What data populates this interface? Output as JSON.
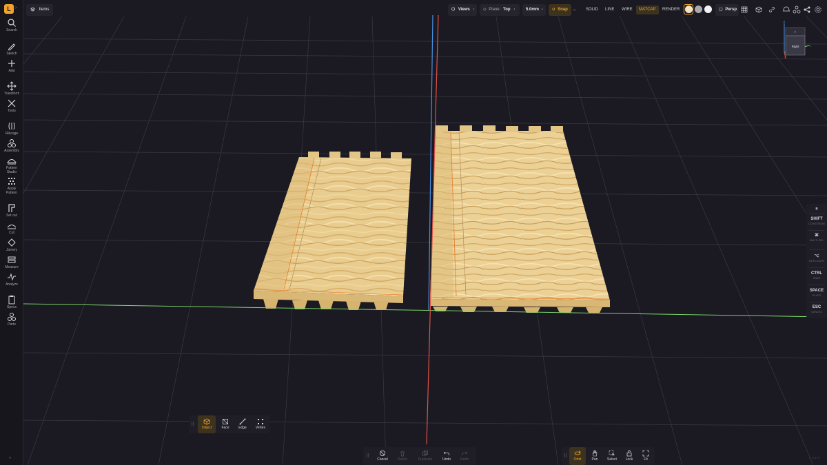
{
  "app": {
    "logo_letter": "L",
    "items_tab_label": "Items",
    "colors": {
      "accent": "#f0a22a",
      "background": "#1b1a22",
      "panel": "#1f1e26",
      "x_axis": "#e0524a",
      "y_axis": "#7cd66a",
      "z_axis": "#4a90e2"
    }
  },
  "left_toolbar": {
    "tools": [
      {
        "label": "Search",
        "icon": "search-icon"
      },
      {
        "label": "Sketch",
        "icon": "pencil-icon"
      },
      {
        "label": "Add",
        "icon": "plus-icon"
      },
      {
        "label": "Transform",
        "icon": "move-icon"
      },
      {
        "label": "Tools",
        "icon": "wrench-icon"
      },
      {
        "label": "Ribcage",
        "icon": "ribcage-icon"
      },
      {
        "label": "Assembly",
        "icon": "assembly-icon"
      },
      {
        "label": "Pattern\nStudio",
        "icon": "pattern-studio-icon"
      },
      {
        "label": "Apply\nPattern",
        "icon": "apply-pattern-icon"
      },
      {
        "label": "Set out",
        "icon": "set-out-icon"
      },
      {
        "label": "Cut",
        "icon": "cut-icon"
      },
      {
        "label": "Joinery",
        "icon": "joinery-icon"
      },
      {
        "label": "Measure",
        "icon": "measure-icon"
      },
      {
        "label": "Analyze",
        "icon": "analyze-icon"
      },
      {
        "label": "Specs",
        "icon": "clipboard-icon"
      },
      {
        "label": "Parts",
        "icon": "parts-icon"
      }
    ]
  },
  "top_bar": {
    "views_label": "Views",
    "plane_label": "Plane:",
    "plane_value": "Top",
    "step_value": "5.0mm",
    "snap_label": "Snap",
    "render_modes": [
      "SOLID",
      "LINE",
      "WIRE",
      "MATCAP",
      "RENDER"
    ],
    "active_render_mode": "MATCAP",
    "projection_label": "Persp"
  },
  "viewcube": {
    "top_label": "F",
    "front_label": "Right",
    "axis_z": "Z",
    "axis_y": "Y",
    "axis_x": "X"
  },
  "shortcuts": [
    {
      "key": "SHIFT",
      "desc": "CONSTRAIN"
    },
    {
      "key": "⌘",
      "desc": "MULTI SEL"
    },
    {
      "key": "⌥",
      "desc": "DUPLICATE"
    },
    {
      "key": "CTRL",
      "desc": "SNAP"
    },
    {
      "key": "SPACE",
      "desc": "PLACE"
    },
    {
      "key": "ESC",
      "desc": "CANCEL"
    }
  ],
  "selection_modes": [
    {
      "label": "Object",
      "icon": "cube-icon",
      "active": true
    },
    {
      "label": "Face",
      "icon": "face-icon",
      "active": false
    },
    {
      "label": "Edge",
      "icon": "edge-icon",
      "active": false
    },
    {
      "label": "Vertex",
      "icon": "vertex-icon",
      "active": false
    }
  ],
  "actions": [
    {
      "label": "Cancel",
      "icon": "cancel-icon",
      "enabled": true
    },
    {
      "label": "Delete",
      "icon": "trash-icon",
      "enabled": false
    },
    {
      "label": "Duplicate",
      "icon": "duplicate-icon",
      "enabled": false
    },
    {
      "label": "Undo",
      "icon": "undo-icon",
      "enabled": true
    },
    {
      "label": "Redo",
      "icon": "redo-icon",
      "enabled": false
    }
  ],
  "nav_tools": [
    {
      "label": "Orbit",
      "icon": "orbit-icon",
      "active": true
    },
    {
      "label": "Pan",
      "icon": "hand-icon",
      "active": false
    },
    {
      "label": "Select",
      "icon": "select-icon",
      "active": false
    },
    {
      "label": "Lock",
      "icon": "lock-icon",
      "active": false
    },
    {
      "label": "Fit",
      "icon": "fit-icon",
      "active": false
    }
  ],
  "corner_text": "Z: 0.0 FT"
}
